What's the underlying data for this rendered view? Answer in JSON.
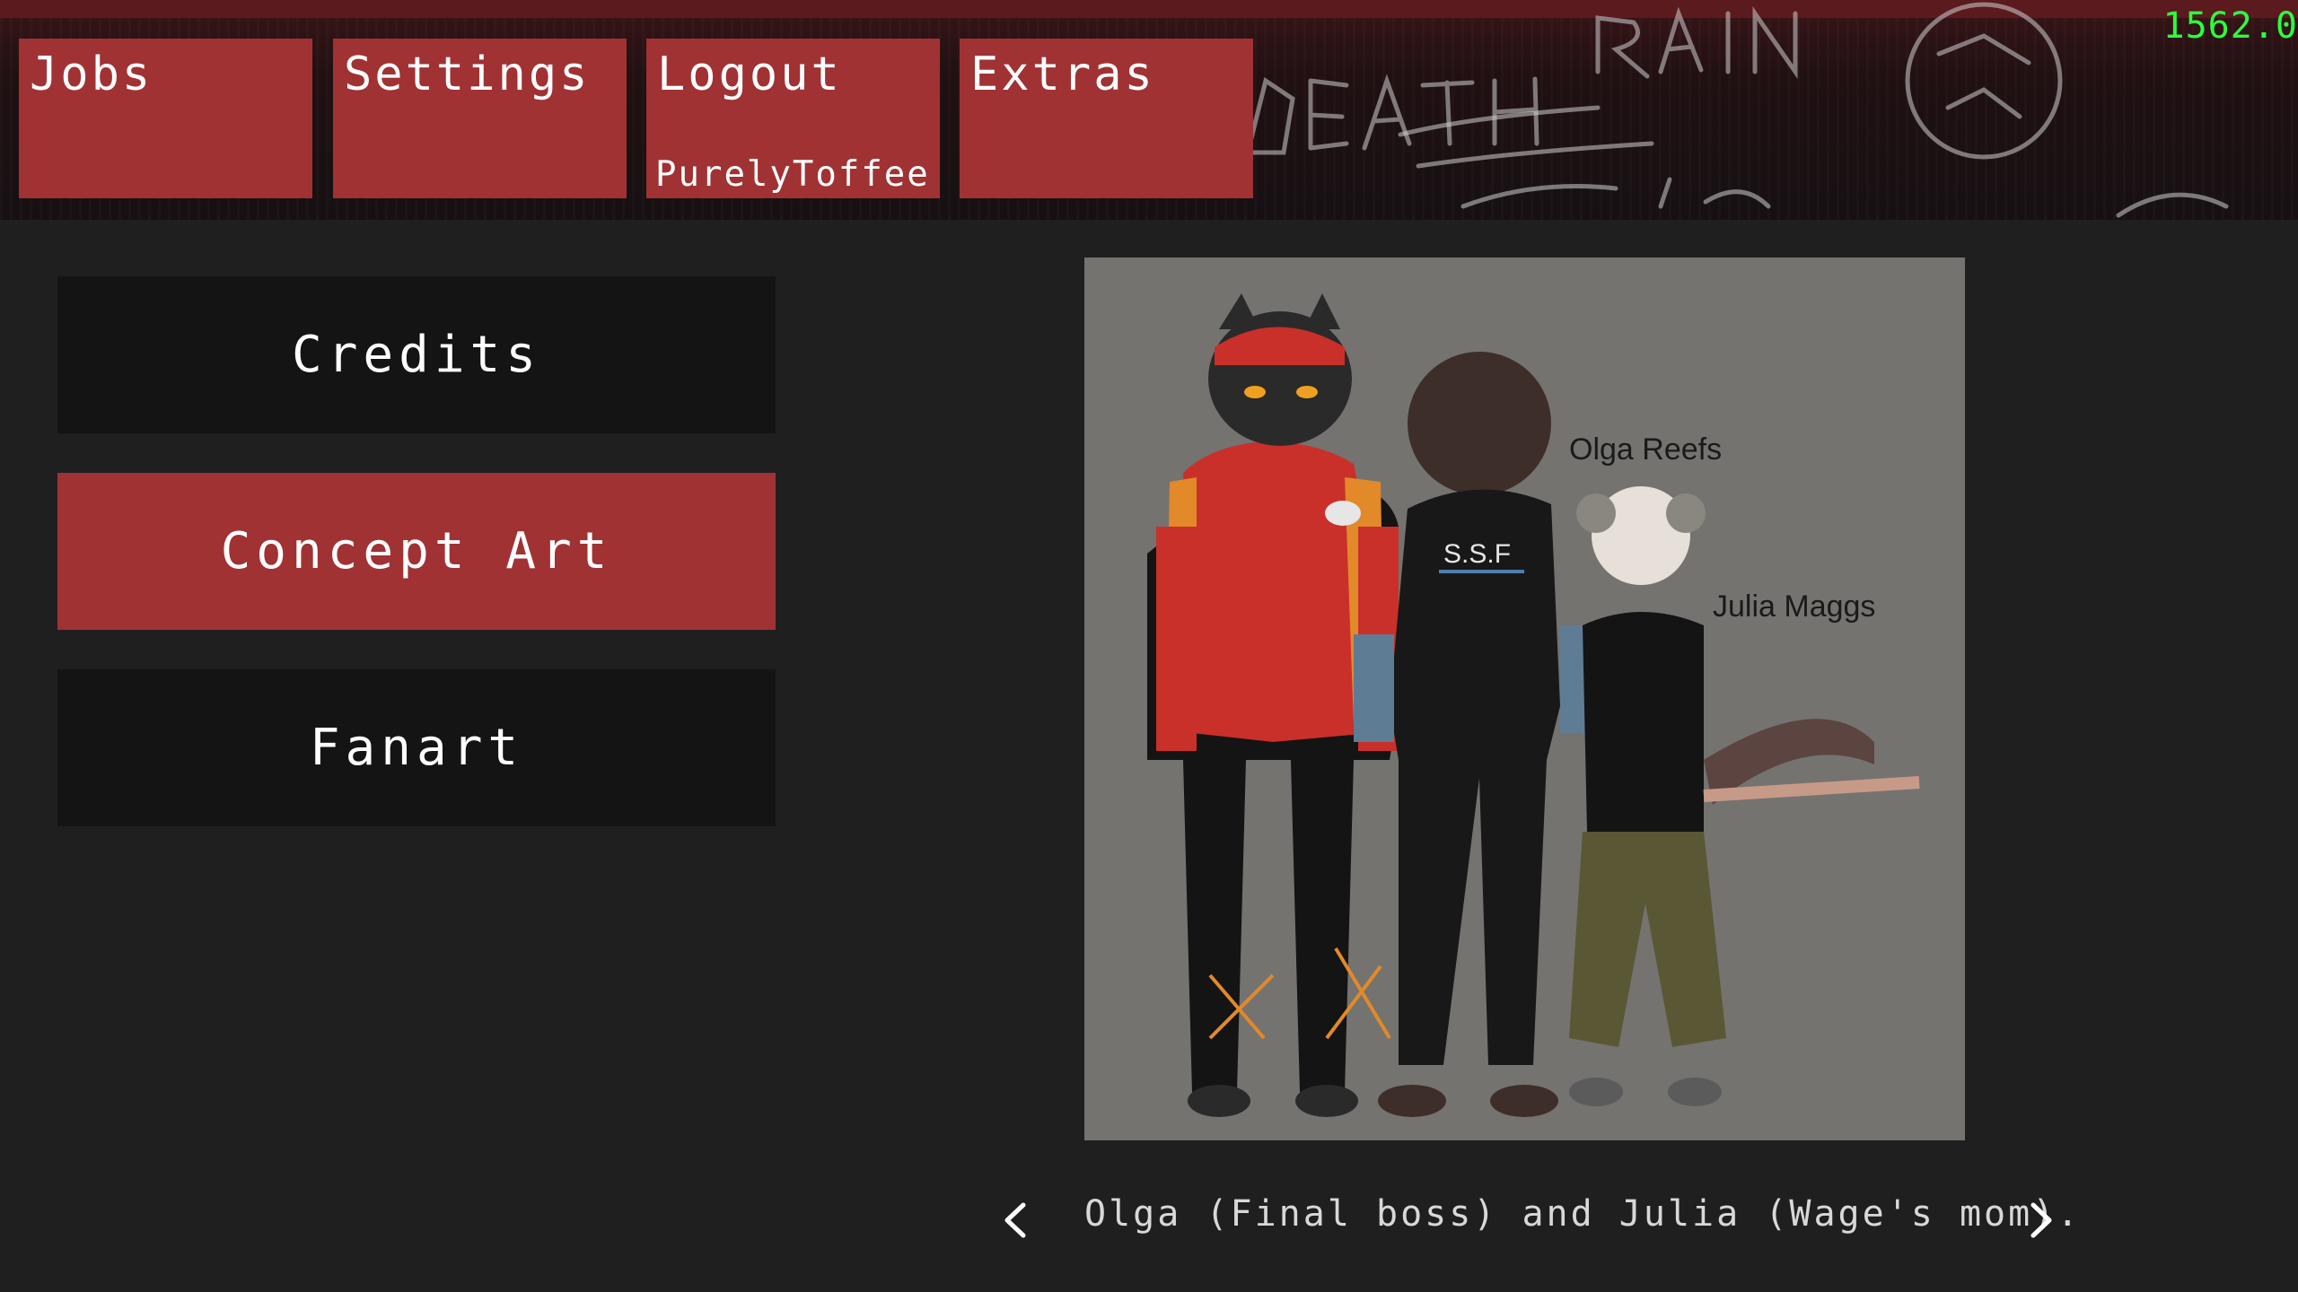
{
  "top_menu": {
    "jobs": "Jobs",
    "settings": "Settings",
    "logout": "Logout",
    "username": "PurelyToffee",
    "extras": "Extras"
  },
  "fps": "1562.0",
  "side_menu": {
    "credits": "Credits",
    "concept_art": "Concept Art",
    "fanart": "Fanart"
  },
  "art": {
    "label_olga": "Olga Reefs",
    "label_julia": "Julia Maggs",
    "badge_text": "S.S.F"
  },
  "caption": "Olga (Final boss) and Julia (Wage's mom).",
  "icons": {
    "prev": "chevron-left-icon",
    "next": "chevron-right-icon"
  },
  "colors": {
    "accent_red": "#a03234",
    "panel_dark": "#141414",
    "fps_green": "#2dff3c"
  }
}
